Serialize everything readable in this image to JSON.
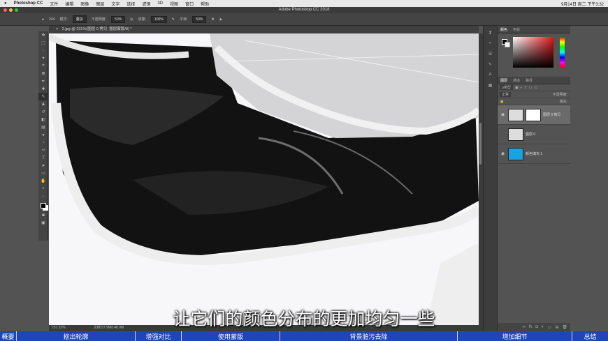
{
  "menubar": {
    "app_name": "Photoshop CC",
    "items": [
      "文件",
      "编辑",
      "图像",
      "图层",
      "文字",
      "选择",
      "滤镜",
      "3D",
      "视图",
      "窗口",
      "帮助"
    ],
    "clock": "9月14日 周二 下午3:32"
  },
  "window": {
    "title": "Adobe Photoshop CC 2018"
  },
  "options_bar": {
    "brush_size": "244",
    "mode_label": "模式:",
    "mode_value": "叠加",
    "opacity_label": "不透明度:",
    "opacity_value": "50%",
    "flow_label": "流量:",
    "flow_value": "100%",
    "smooth_label": "平滑:",
    "smooth_value": "50%"
  },
  "document": {
    "tab": "2.jpg @ 231%(图层 0 拷贝, 图层蒙版/8) *",
    "zoom": "231.32%",
    "doc_info": "文档:57.9M/148.0M"
  },
  "color_panel": {
    "tabs": [
      "颜色",
      "色板"
    ]
  },
  "layers_panel": {
    "tabs": [
      "图层",
      "通道",
      "路径"
    ],
    "filter_label": "ρ类型",
    "blend_mode": "正常",
    "opacity_label": "不透明度:",
    "fill_label": "填充:",
    "layers": [
      {
        "name": "图层 0 拷贝",
        "selected": true
      },
      {
        "name": "图层 0",
        "selected": false
      },
      {
        "name": "颜色填充 1",
        "selected": false
      }
    ]
  },
  "subtitle": "让它们的颜色分布的更加均匀一些",
  "chapters": [
    {
      "label": "概要"
    },
    {
      "label": "抠出轮廓"
    },
    {
      "label": "增强对比"
    },
    {
      "label": "使用蒙版"
    },
    {
      "label": "背景脏污去除"
    },
    {
      "label": "增加细节"
    },
    {
      "label": "总结"
    }
  ],
  "colors": {
    "chapter_bar": "#1e46b8",
    "accent_red": "#e4131b",
    "layer_fill_thumb": "#1aa3e0"
  }
}
